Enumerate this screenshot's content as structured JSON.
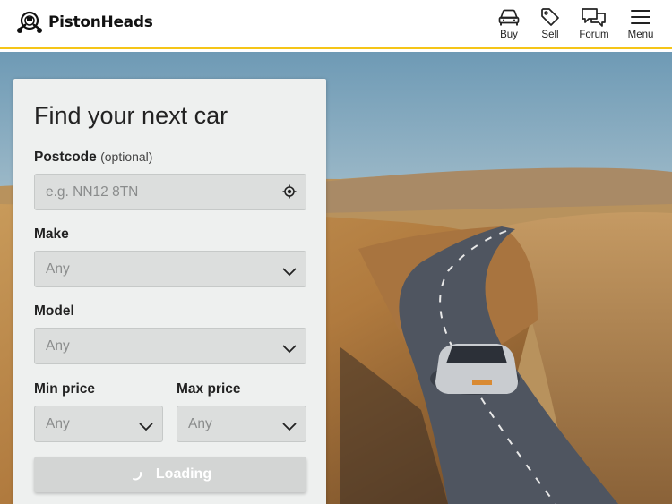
{
  "brand": {
    "name": "PistonHeads"
  },
  "nav": [
    {
      "label": "Buy",
      "icon": "car-icon"
    },
    {
      "label": "Sell",
      "icon": "tag-icon"
    },
    {
      "label": "Forum",
      "icon": "chat-icon"
    },
    {
      "label": "Menu",
      "icon": "hamburger-icon"
    }
  ],
  "search": {
    "title": "Find your next car",
    "postcode_label": "Postcode",
    "postcode_optional": "(optional)",
    "postcode_placeholder": "e.g. NN12 8TN",
    "make_label": "Make",
    "make_value": "Any",
    "model_label": "Model",
    "model_value": "Any",
    "min_price_label": "Min price",
    "min_price_value": "Any",
    "max_price_label": "Max price",
    "max_price_value": "Any",
    "submit_label": "Loading"
  },
  "colors": {
    "accent": "#f5c518"
  }
}
